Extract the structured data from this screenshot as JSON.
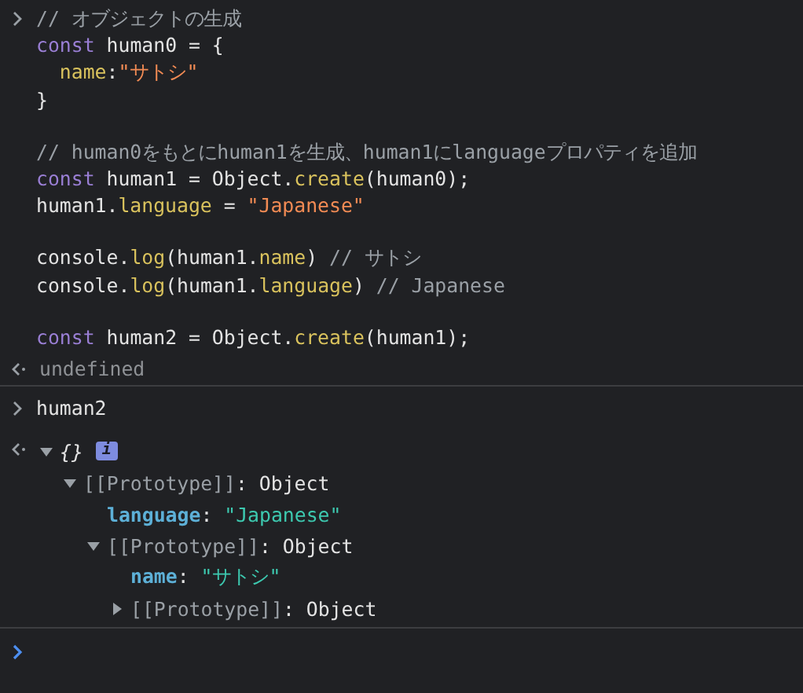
{
  "console": [
    {
      "kind": "input",
      "paragraphs": [
        [
          [
            {
              "kind": "comment",
              "text": "// オブジェクトの生成"
            }
          ],
          [
            {
              "kind": "keyword",
              "text": "const"
            },
            {
              "kind": "plain",
              "text": " human0 = {"
            }
          ],
          [
            {
              "kind": "prop",
              "text": "  name"
            },
            {
              "kind": "plain",
              "text": ":"
            },
            {
              "kind": "string",
              "text": "\"サトシ\""
            }
          ],
          [
            {
              "kind": "plain",
              "text": "}"
            }
          ]
        ],
        [
          [
            {
              "kind": "comment",
              "text": "// human0をもとにhuman1を生成、human1にlanguageプロパティを追加"
            }
          ],
          [
            {
              "kind": "keyword",
              "text": "const"
            },
            {
              "kind": "plain",
              "text": " human1 = Object."
            },
            {
              "kind": "prop",
              "text": "create"
            },
            {
              "kind": "plain",
              "text": "(human0);"
            }
          ],
          [
            {
              "kind": "plain",
              "text": "human1."
            },
            {
              "kind": "prop",
              "text": "language"
            },
            {
              "kind": "plain",
              "text": " = "
            },
            {
              "kind": "string",
              "text": "\"Japanese\""
            }
          ]
        ],
        [
          [
            {
              "kind": "plain",
              "text": "console."
            },
            {
              "kind": "prop",
              "text": "log"
            },
            {
              "kind": "plain",
              "text": "(human1."
            },
            {
              "kind": "prop",
              "text": "name"
            },
            {
              "kind": "plain",
              "text": ") "
            },
            {
              "kind": "comment",
              "text": "// サトシ"
            }
          ],
          [
            {
              "kind": "plain",
              "text": "console."
            },
            {
              "kind": "prop",
              "text": "log"
            },
            {
              "kind": "plain",
              "text": "(human1."
            },
            {
              "kind": "prop",
              "text": "language"
            },
            {
              "kind": "plain",
              "text": ") "
            },
            {
              "kind": "comment",
              "text": "// Japanese"
            }
          ]
        ],
        [
          [
            {
              "kind": "keyword",
              "text": "const"
            },
            {
              "kind": "plain",
              "text": " human2 = Object."
            },
            {
              "kind": "prop",
              "text": "create"
            },
            {
              "kind": "plain",
              "text": "(human1);"
            }
          ]
        ]
      ]
    },
    {
      "kind": "result",
      "text": "undefined"
    },
    {
      "kind": "input",
      "paragraphs": [
        [
          [
            {
              "kind": "plain",
              "text": "human2"
            }
          ]
        ]
      ]
    },
    {
      "kind": "object",
      "preview": "{}",
      "badge": "i",
      "expanded": true,
      "children": [
        {
          "kind": "prototype",
          "label": "[[Prototype]]",
          "separator": ":",
          "value": "Object",
          "expanded": true,
          "children": [
            {
              "kind": "property",
              "key": "language",
              "separator": ":",
              "value": "\"Japanese\""
            },
            {
              "kind": "prototype",
              "label": "[[Prototype]]",
              "separator": ":",
              "value": "Object",
              "expanded": true,
              "children": [
                {
                  "kind": "property",
                  "key": "name",
                  "separator": ":",
                  "value": "\"サトシ\""
                },
                {
                  "kind": "prototype",
                  "label": "[[Prototype]]",
                  "separator": ":",
                  "value": "Object",
                  "expanded": false
                }
              ]
            }
          ]
        }
      ]
    }
  ]
}
